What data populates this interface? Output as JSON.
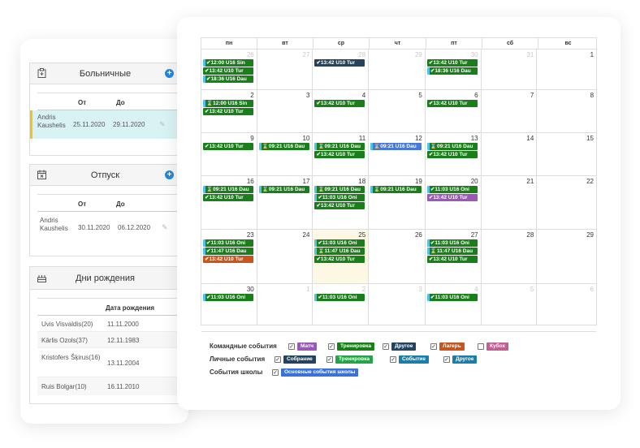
{
  "sick": {
    "title": "Больничные",
    "col_from": "От",
    "col_to": "До",
    "rows": [
      {
        "name": "Andris Kaushelis",
        "from": "25.11.2020",
        "to": "29.11.2020"
      }
    ]
  },
  "vacation": {
    "title": "Отпуск",
    "col_from": "От",
    "col_to": "До",
    "rows": [
      {
        "name": "Andris Kaushelis",
        "from": "30.11.2020",
        "to": "06.12.2020"
      }
    ]
  },
  "birthdays": {
    "title": "Дни рождения",
    "col_date": "Дата рождения",
    "rows": [
      {
        "name": "Uvis Visvaldis(20)",
        "date": "11.11.2000"
      },
      {
        "name": "Kārlis Ozols(37)",
        "date": "12.11.1983"
      },
      {
        "name": "Kristofers Šķirus(16)",
        "date": "13.11.2004"
      },
      {
        "name": "Ruis Bolgar(10)",
        "date": "16.11.2010"
      }
    ]
  },
  "calendar": {
    "weekdays": [
      "пн",
      "вт",
      "ср",
      "чт",
      "пт",
      "сб",
      "вс"
    ],
    "weeks": [
      {
        "days": [
          {
            "num": "26",
            "other": true,
            "events": [
              {
                "text": "✔12:00 U16 Sin",
                "color": "#1a7f1a",
                "bar": true
              },
              {
                "text": "✔13:42 U10 Tur",
                "color": "#1a7f1a",
                "bar": false
              },
              {
                "text": "✔18:36 U16 Dau",
                "color": "#1a7f1a",
                "bar": true
              }
            ]
          },
          {
            "num": "27",
            "other": true,
            "events": []
          },
          {
            "num": "28",
            "other": true,
            "events": [
              {
                "text": "✔13:42 U10 Tur",
                "color": "#24435e",
                "bar": false
              }
            ]
          },
          {
            "num": "29",
            "other": true,
            "events": []
          },
          {
            "num": "30",
            "other": true,
            "events": [
              {
                "text": "✔13:42 U10 Tur",
                "color": "#1a7f1a",
                "bar": false
              },
              {
                "text": "✔18:36 U16 Dau",
                "color": "#1a7f1a",
                "bar": true
              }
            ]
          },
          {
            "num": "31",
            "other": true,
            "events": []
          },
          {
            "num": "1",
            "other": false,
            "events": []
          }
        ]
      },
      {
        "days": [
          {
            "num": "2",
            "other": false,
            "events": [
              {
                "text": "⌛12:00 U16 Sin",
                "color": "#1a7f1a",
                "bar": true
              },
              {
                "text": "✔13:42 U10 Tur",
                "color": "#1a7f1a",
                "bar": false
              }
            ]
          },
          {
            "num": "3",
            "other": false,
            "events": []
          },
          {
            "num": "4",
            "other": false,
            "events": [
              {
                "text": "✔13:42 U10 Tur",
                "color": "#1a7f1a",
                "bar": false
              }
            ]
          },
          {
            "num": "5",
            "other": false,
            "events": []
          },
          {
            "num": "6",
            "other": false,
            "events": [
              {
                "text": "✔13:42 U10 Tur",
                "color": "#1a7f1a",
                "bar": false
              }
            ]
          },
          {
            "num": "7",
            "other": false,
            "events": []
          },
          {
            "num": "8",
            "other": false,
            "events": []
          }
        ]
      },
      {
        "days": [
          {
            "num": "9",
            "other": false,
            "events": [
              {
                "text": "✔13:42 U10 Tur",
                "color": "#1a7f1a",
                "bar": false
              }
            ]
          },
          {
            "num": "10",
            "other": false,
            "events": [
              {
                "text": "⌛09:21 U16 Dau",
                "color": "#1a7f1a",
                "bar": true
              }
            ]
          },
          {
            "num": "11",
            "other": false,
            "events": [
              {
                "text": "⌛09:21 U16 Dau",
                "color": "#1a7f1a",
                "bar": true
              },
              {
                "text": "✔13:42 U10 Tur",
                "color": "#1a7f1a",
                "bar": false
              }
            ]
          },
          {
            "num": "12",
            "other": false,
            "events": [
              {
                "text": "⌛09:21 U16 Dau",
                "color": "#4a78d6",
                "bar": true
              }
            ]
          },
          {
            "num": "13",
            "other": false,
            "events": [
              {
                "text": "⌛09:21 U16 Dau",
                "color": "#1a7f1a",
                "bar": true
              },
              {
                "text": "✔13:42 U10 Tur",
                "color": "#1a7f1a",
                "bar": false
              }
            ]
          },
          {
            "num": "14",
            "other": false,
            "events": []
          },
          {
            "num": "15",
            "other": false,
            "events": []
          }
        ]
      },
      {
        "days": [
          {
            "num": "16",
            "other": false,
            "events": [
              {
                "text": "⌛09:21 U16 Dau",
                "color": "#1a7f1a",
                "bar": true
              },
              {
                "text": "✔13:42 U10 Tur",
                "color": "#1a7f1a",
                "bar": false
              }
            ]
          },
          {
            "num": "17",
            "other": false,
            "events": [
              {
                "text": "⌛09:21 U16 Dau",
                "color": "#1a7f1a",
                "bar": true
              }
            ]
          },
          {
            "num": "18",
            "other": false,
            "events": [
              {
                "text": "⌛09:21 U16 Dau",
                "color": "#1a7f1a",
                "bar": true
              },
              {
                "text": "✔11:03 U16 Oni",
                "color": "#1a7f1a",
                "bar": true
              },
              {
                "text": "✔13:42 U10 Tur",
                "color": "#1a7f1a",
                "bar": false
              }
            ]
          },
          {
            "num": "19",
            "other": false,
            "events": [
              {
                "text": "⌛09:21 U16 Dau",
                "color": "#1a7f1a",
                "bar": true
              }
            ]
          },
          {
            "num": "20",
            "other": false,
            "events": [
              {
                "text": "✔11:03 U16 Oni",
                "color": "#1a7f1a",
                "bar": true
              },
              {
                "text": "✔13:42 U10 Tur",
                "color": "#9b59b6",
                "bar": false
              }
            ]
          },
          {
            "num": "21",
            "other": false,
            "events": []
          },
          {
            "num": "22",
            "other": false,
            "events": []
          }
        ]
      },
      {
        "days": [
          {
            "num": "23",
            "other": false,
            "events": [
              {
                "text": "✔11:03 U16 Oni",
                "color": "#1a7f1a",
                "bar": true
              },
              {
                "text": "✔11:47 U16 Dau",
                "color": "#1a7f1a",
                "bar": true
              },
              {
                "text": "✔13:42 U10 Tur",
                "color": "#c8551b",
                "bar": false
              }
            ]
          },
          {
            "num": "24",
            "other": false,
            "events": []
          },
          {
            "num": "25",
            "other": false,
            "today": true,
            "events": [
              {
                "text": "✔11:03 U16 Oni",
                "color": "#1a7f1a",
                "bar": true
              },
              {
                "text": "⌛11:47 U16 Dau",
                "color": "#1a7f1a",
                "bar": true
              },
              {
                "text": "✔13:42 U10 Tur",
                "color": "#1a7f1a",
                "bar": false
              }
            ]
          },
          {
            "num": "26",
            "other": false,
            "events": []
          },
          {
            "num": "27",
            "other": false,
            "events": [
              {
                "text": "✔11:03 U16 Oni",
                "color": "#1a7f1a",
                "bar": true
              },
              {
                "text": "⌛11:47 U16 Dau",
                "color": "#1a7f1a",
                "bar": true
              },
              {
                "text": "✔13:42 U10 Tur",
                "color": "#1a7f1a",
                "bar": false
              }
            ]
          },
          {
            "num": "28",
            "other": false,
            "events": []
          },
          {
            "num": "29",
            "other": false,
            "events": []
          }
        ]
      },
      {
        "days": [
          {
            "num": "30",
            "other": false,
            "events": [
              {
                "text": "✔11:03 U16 Oni",
                "color": "#1a7f1a",
                "bar": true
              }
            ]
          },
          {
            "num": "1",
            "other": true,
            "events": []
          },
          {
            "num": "2",
            "other": true,
            "events": [
              {
                "text": "✔11:03 U16 Oni",
                "color": "#1a7f1a",
                "bar": true
              }
            ]
          },
          {
            "num": "3",
            "other": true,
            "events": []
          },
          {
            "num": "4",
            "other": true,
            "events": [
              {
                "text": "✔11:03 U16 Oni",
                "color": "#1a7f1a",
                "bar": true
              }
            ]
          },
          {
            "num": "5",
            "other": true,
            "events": []
          },
          {
            "num": "6",
            "other": true,
            "events": []
          }
        ]
      }
    ]
  },
  "legend": {
    "team_label": "Командные события",
    "personal_label": "Личные события",
    "school_label": "События школы",
    "team": [
      {
        "label": "Матч",
        "color": "#9b59b6",
        "checked": true
      },
      {
        "label": "Тренировка",
        "color": "#1a7f1a",
        "checked": true
      },
      {
        "label": "Другое",
        "color": "#24435e",
        "checked": true
      },
      {
        "label": "Лагерь",
        "color": "#c8551b",
        "checked": true
      },
      {
        "label": "Кубок",
        "color": "#c05f92",
        "checked": false
      }
    ],
    "personal": [
      {
        "label": "Собрание",
        "color": "#24435e",
        "checked": true
      },
      {
        "label": "Тренировка",
        "color": "#27a34a",
        "checked": true
      },
      {
        "label": "Событие",
        "color": "#1a7fa8",
        "checked": true
      },
      {
        "label": "Другое",
        "color": "#1a7fa8",
        "checked": true
      }
    ],
    "school": [
      {
        "label": "Основные события школы",
        "color": "#3b72d9",
        "checked": true
      }
    ]
  },
  "colors": {
    "highlight": "#d9f3f5",
    "highlight_bar": "#f0c419",
    "event_bar": "#4fc3e8"
  }
}
